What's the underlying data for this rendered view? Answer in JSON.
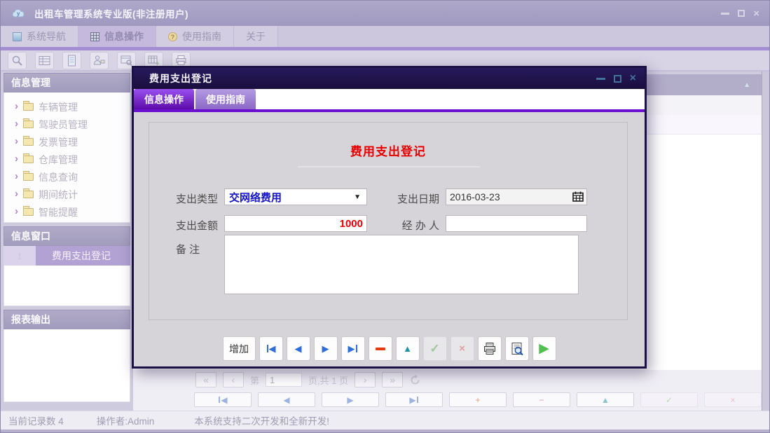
{
  "window": {
    "title": "出租车管理系统专业版(非注册用户)"
  },
  "main_tabs": [
    {
      "label": "系统导航"
    },
    {
      "label": "信息操作"
    },
    {
      "label": "使用指南"
    },
    {
      "label": "关于"
    }
  ],
  "toolbar": {
    "icons": [
      "search-icon",
      "table-icon",
      "document-icon",
      "user-icon",
      "window-search-icon",
      "table-add-icon",
      "printer-icon"
    ]
  },
  "sidebar": {
    "info_manage": {
      "title": "信息管理",
      "items": [
        {
          "label": "车辆管理"
        },
        {
          "label": "驾驶员管理"
        },
        {
          "label": "发票管理"
        },
        {
          "label": "仓库管理"
        },
        {
          "label": "信息查询"
        },
        {
          "label": "期间统计"
        },
        {
          "label": "智能提醒"
        }
      ]
    },
    "info_window": {
      "title": "信息窗口",
      "row": {
        "index": "1",
        "label": "费用支出登记"
      }
    },
    "report_output": {
      "title": "报表输出"
    }
  },
  "dialog": {
    "title": "费用支出登记",
    "tabs": [
      {
        "label": "信息操作"
      },
      {
        "label": "使用指南"
      }
    ],
    "form": {
      "heading": "费用支出登记",
      "expense_type_label": "支出类型",
      "expense_type_value": "交网络费用",
      "expense_date_label": "支出日期",
      "expense_date_value": "2016-03-23",
      "amount_label": "支出金额",
      "amount_value": "1000",
      "handler_label": "经 办 人",
      "handler_value": "",
      "remark_label": "备 注",
      "remark_value": ""
    },
    "add_button": "增加"
  },
  "pagination": {
    "page_prefix": "第",
    "page_value": "1",
    "page_suffix": "页,共 1 页"
  },
  "statusbar": {
    "record_count": "当前记录数 4",
    "operator": "操作者:Admin",
    "message": "本系统支持二次开发和全新开发!"
  },
  "colors": {
    "accent_purple": "#6b0fd0",
    "dialog_frame": "#1c1145",
    "heading_red": "#e60000",
    "value_blue": "#1414c8",
    "amount_red": "#e80000"
  },
  "glyphs": {
    "chevron": "›",
    "dropdown": "▼",
    "arrow_left": "◀",
    "arrow_right": "▶",
    "arrow_up": "▲",
    "plus": "+",
    "minus": "−",
    "check": "✓",
    "cross": "×",
    "run": "▶",
    "pg_first": "«",
    "pg_prev": "‹",
    "pg_next": "›",
    "pg_last": "»",
    "collapse": "▲",
    "close": "×"
  }
}
